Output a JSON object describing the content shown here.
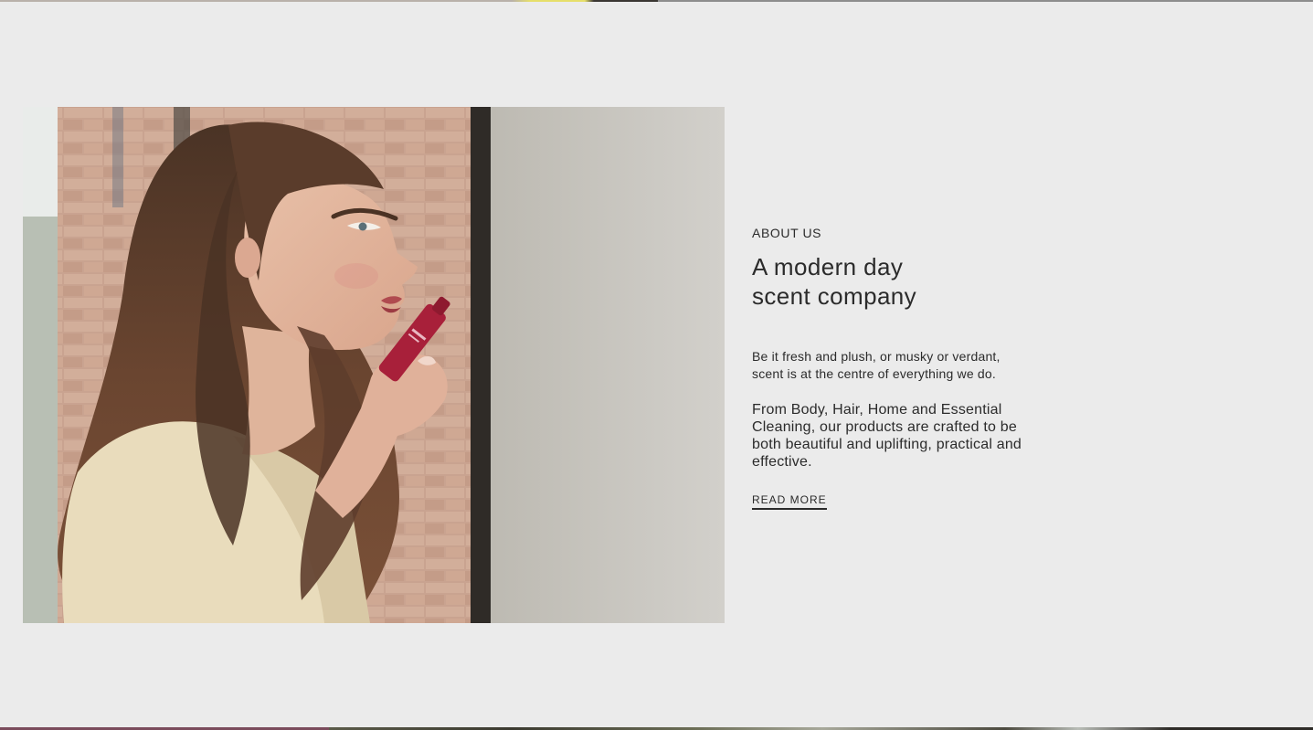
{
  "about": {
    "eyebrow": "ABOUT US",
    "heading_line1": "A modern day",
    "heading_line2": "scent company",
    "lead": "Be it fresh and plush, or musky or verdant, scent is at the centre of everything we do.",
    "body": "From Body, Hair, Home and Essential Cleaning, our products are crafted to be both beautiful and uplifting, practical and effective.",
    "read_more_label": "READ MORE"
  },
  "colors": {
    "page_background": "#ebebeb",
    "text": "#2b2b2b",
    "product_red": "#a8203a"
  }
}
